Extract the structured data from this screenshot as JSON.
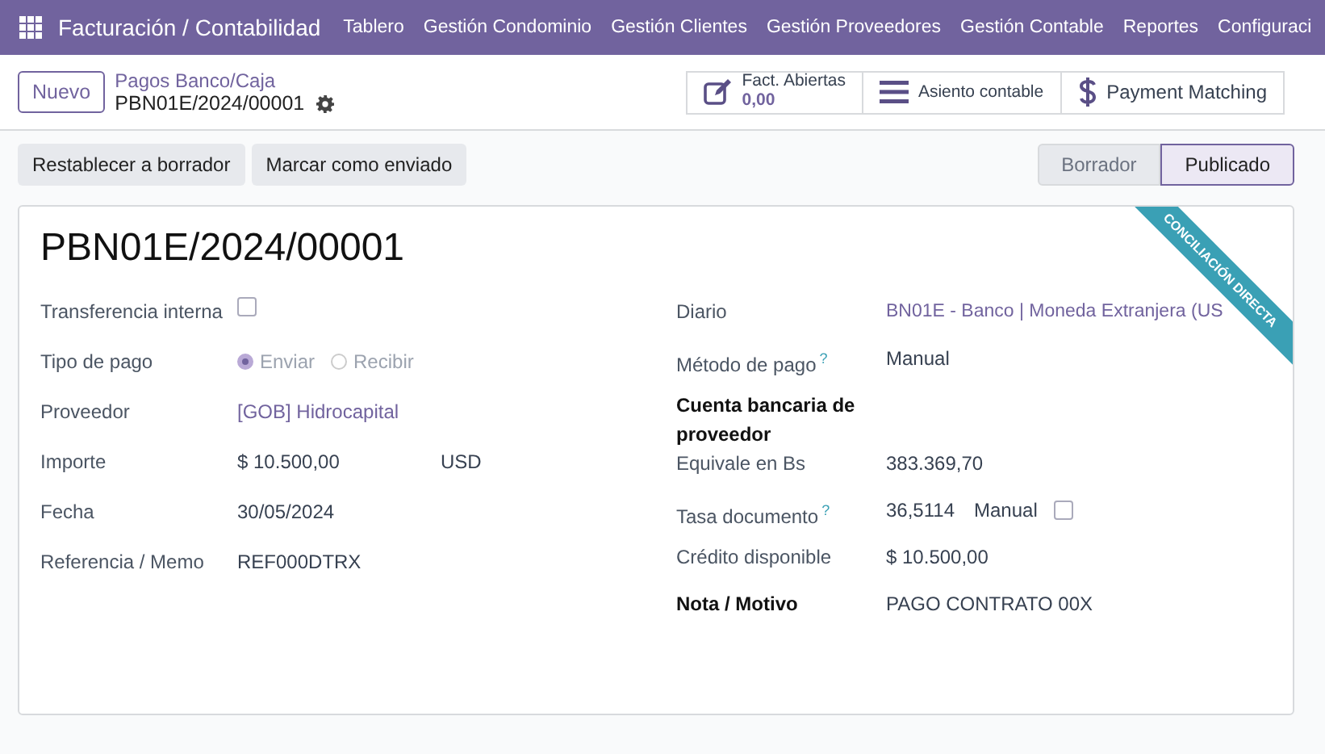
{
  "navbar": {
    "app_title": "Facturación / Contabilidad",
    "menu": [
      "Tablero",
      "Gestión Condominio",
      "Gestión Clientes",
      "Gestión Proveedores",
      "Gestión Contable",
      "Reportes",
      "Configuraci"
    ]
  },
  "control_panel": {
    "new_button": "Nuevo",
    "breadcrumb_parent": "Pagos Banco/Caja",
    "record_name": "PBN01E/2024/00001",
    "smart_buttons": [
      {
        "kind": "stat",
        "label": "Fact. Abiertas",
        "value": "0,00"
      },
      {
        "kind": "lines",
        "label": "Asiento contable"
      },
      {
        "kind": "dollar",
        "label": "Payment Matching"
      }
    ]
  },
  "actions": {
    "buttons": [
      "Restablecer a borrador",
      "Marcar como enviado"
    ],
    "statusbar": [
      {
        "label": "Borrador",
        "selected": false
      },
      {
        "label": "Publicado",
        "selected": true
      }
    ]
  },
  "form": {
    "title": "PBN01E/2024/00001",
    "ribbon": "CONCILIACIÓN DIRECTA",
    "left_fields": [
      {
        "kind": "checkbox",
        "label": "Transferencia interna",
        "checked": false
      },
      {
        "kind": "radio",
        "label": "Tipo de pago",
        "options": [
          {
            "label": "Enviar",
            "selected": true
          },
          {
            "label": "Recibir",
            "selected": false
          }
        ]
      },
      {
        "kind": "link",
        "label": "Proveedor",
        "value": "[GOB] Hidrocapital"
      },
      {
        "kind": "amount",
        "label": "Importe",
        "value": "$ 10.500,00",
        "currency": "USD"
      },
      {
        "kind": "text",
        "label": "Fecha",
        "value": "30/05/2024"
      },
      {
        "kind": "text",
        "label": "Referencia / Memo",
        "value": "REF000DTRX"
      }
    ],
    "right_fields": [
      {
        "kind": "link",
        "label": "Diario",
        "value": "BN01E - Banco | Moneda Extranjera (US"
      },
      {
        "kind": "text",
        "label": "Método de pago",
        "help": "?",
        "value": "Manual"
      },
      {
        "kind": "empty",
        "label": "Cuenta bancaria de proveedor",
        "bold": true
      },
      {
        "kind": "text",
        "label": "Equivale en Bs",
        "value": "383.369,70"
      },
      {
        "kind": "rate",
        "label": "Tasa documento",
        "help": "?",
        "value": "36,5114",
        "option": "Manual",
        "checked": false
      },
      {
        "kind": "text",
        "label": "Crédito disponible",
        "value": "$ 10.500,00"
      },
      {
        "kind": "text",
        "label": "Nota / Motivo",
        "value": "PAGO CONTRATO 00X",
        "bold": true
      }
    ]
  }
}
